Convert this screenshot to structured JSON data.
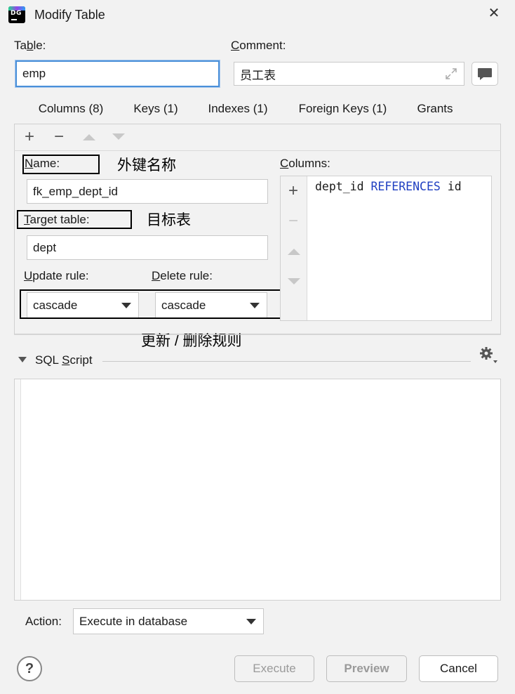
{
  "window": {
    "title": "Modify Table",
    "close": "✕"
  },
  "table": {
    "label_pre": "Ta",
    "label_mn": "b",
    "label_post": "le:",
    "value": "emp"
  },
  "comment": {
    "label_mn": "C",
    "label_post": "omment:",
    "value": "员工表"
  },
  "tabs": [
    {
      "label": "Columns (8)"
    },
    {
      "label": "Keys (1)"
    },
    {
      "label": "Indexes (1)"
    },
    {
      "label": "Foreign Keys (1)",
      "active": true
    },
    {
      "label": "Grants"
    }
  ],
  "toolbar": {
    "add": "+",
    "remove": "−"
  },
  "fk": {
    "name_label_mn": "N",
    "name_label_post": "ame:",
    "name_value": "fk_emp_dept_id",
    "target_label_mn": "T",
    "target_label_post": "arget table:",
    "target_value": "dept",
    "update_label_mn": "U",
    "update_label_post": "pdate rule:",
    "update_value": "cascade",
    "delete_label_mn": "D",
    "delete_label_post": "elete rule:",
    "delete_value": "cascade",
    "columns_label_mn": "C",
    "columns_label_post": "olumns:",
    "columns_add": "+",
    "columns_remove": "−",
    "column_ref": {
      "col": "dept_id",
      "kw": "REFERENCES",
      "ref": "id"
    }
  },
  "annotations": {
    "name": "外键名称",
    "target": "目标表",
    "rules": "更新 / 删除规则"
  },
  "sql": {
    "label_pre": "SQL ",
    "label_mn": "S",
    "label_post": "cript"
  },
  "action": {
    "label": "Action:",
    "value": "Execute in database"
  },
  "buttons": {
    "help": "?",
    "execute": "Execute",
    "preview": "Preview",
    "cancel": "Cancel"
  }
}
